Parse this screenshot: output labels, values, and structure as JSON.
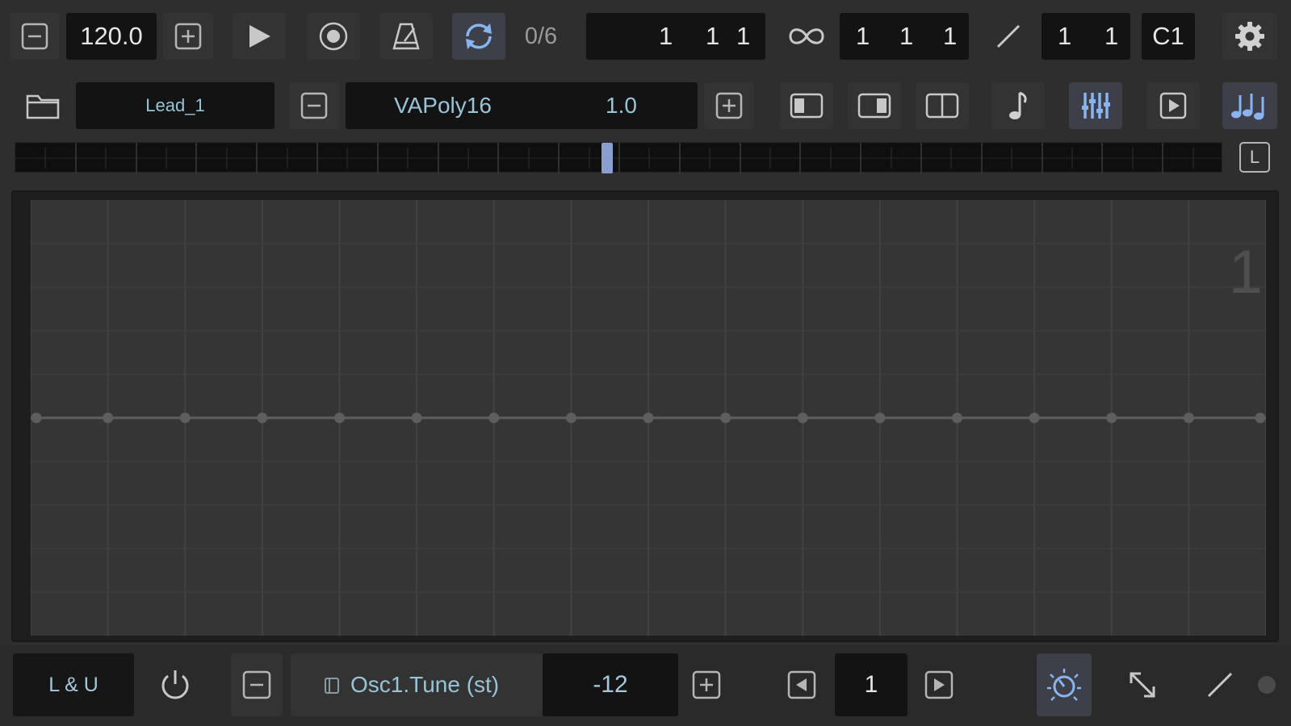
{
  "transport": {
    "tempo": "120.0",
    "pattern_counter": "0/6",
    "position": [
      "1",
      "1",
      "1"
    ],
    "loop_position": [
      "1",
      "1",
      "1"
    ],
    "signature": [
      "1",
      "1"
    ],
    "root_note": "C1"
  },
  "track": {
    "name": "Lead_1",
    "instrument": "VAPoly16",
    "version": "1.0"
  },
  "timeline": {
    "mode_label": "L",
    "playhead_fraction": 0.49
  },
  "editor": {
    "page_number": "1",
    "point_count": 17,
    "value_level": 0.5
  },
  "automation": {
    "mode_label": "L & U",
    "parameter": "Osc1.Tune (st)",
    "value": "-12",
    "page": "1"
  },
  "colors": {
    "accent_blue": "#8ab4f0",
    "field_bg": "#131313",
    "param_text": "#98c4d8"
  },
  "icons": {
    "minus": "minus-icon",
    "plus": "plus-icon",
    "play": "play-icon",
    "record": "record-icon",
    "metronome": "metronome-icon",
    "loop": "loop-icon",
    "infinity": "infinity-icon",
    "pencil": "pencil-icon",
    "gear": "gear-icon",
    "folder": "folder-icon",
    "power": "power-icon",
    "expand": "expand-icon"
  }
}
